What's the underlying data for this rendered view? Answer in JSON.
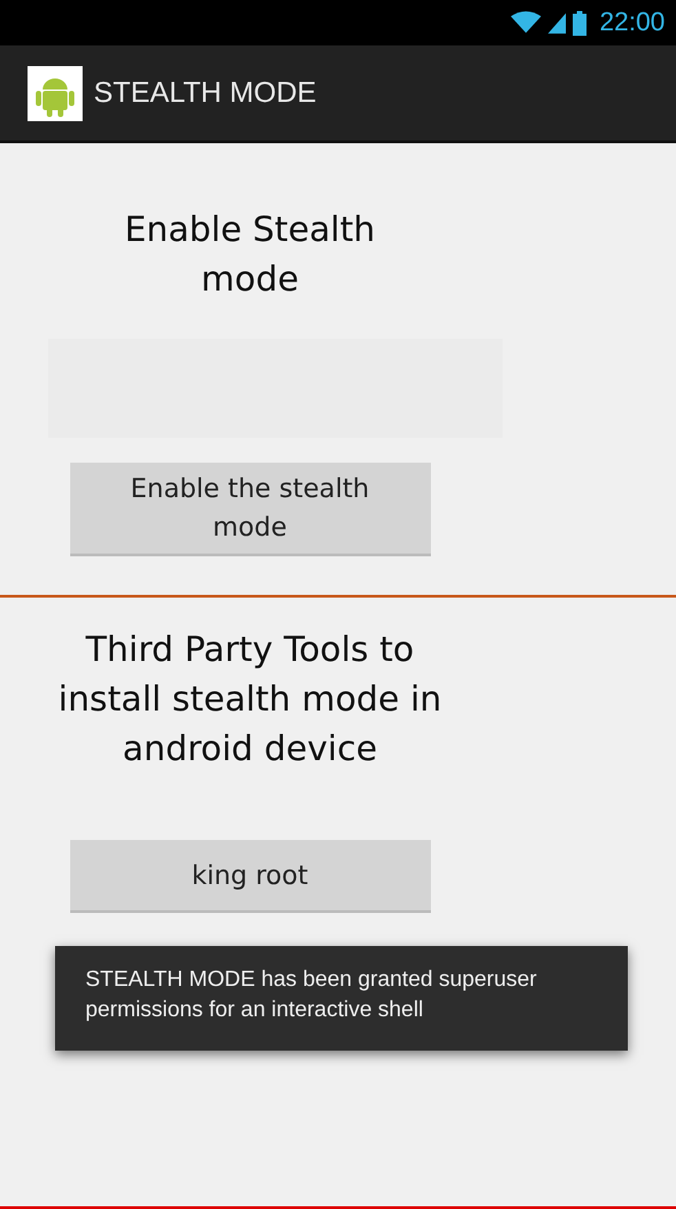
{
  "status_bar": {
    "time": "22:00"
  },
  "action_bar": {
    "title": "STEALTH MODE"
  },
  "sections": [
    {
      "heading": "Enable Stealth mode",
      "button": "Enable the stealth mode"
    },
    {
      "heading": "Third Party Tools to install stealth mode in android device",
      "button": "king root"
    }
  ],
  "toast": {
    "message": "STEALTH MODE has been granted superuser permissions for an interactive shell"
  }
}
